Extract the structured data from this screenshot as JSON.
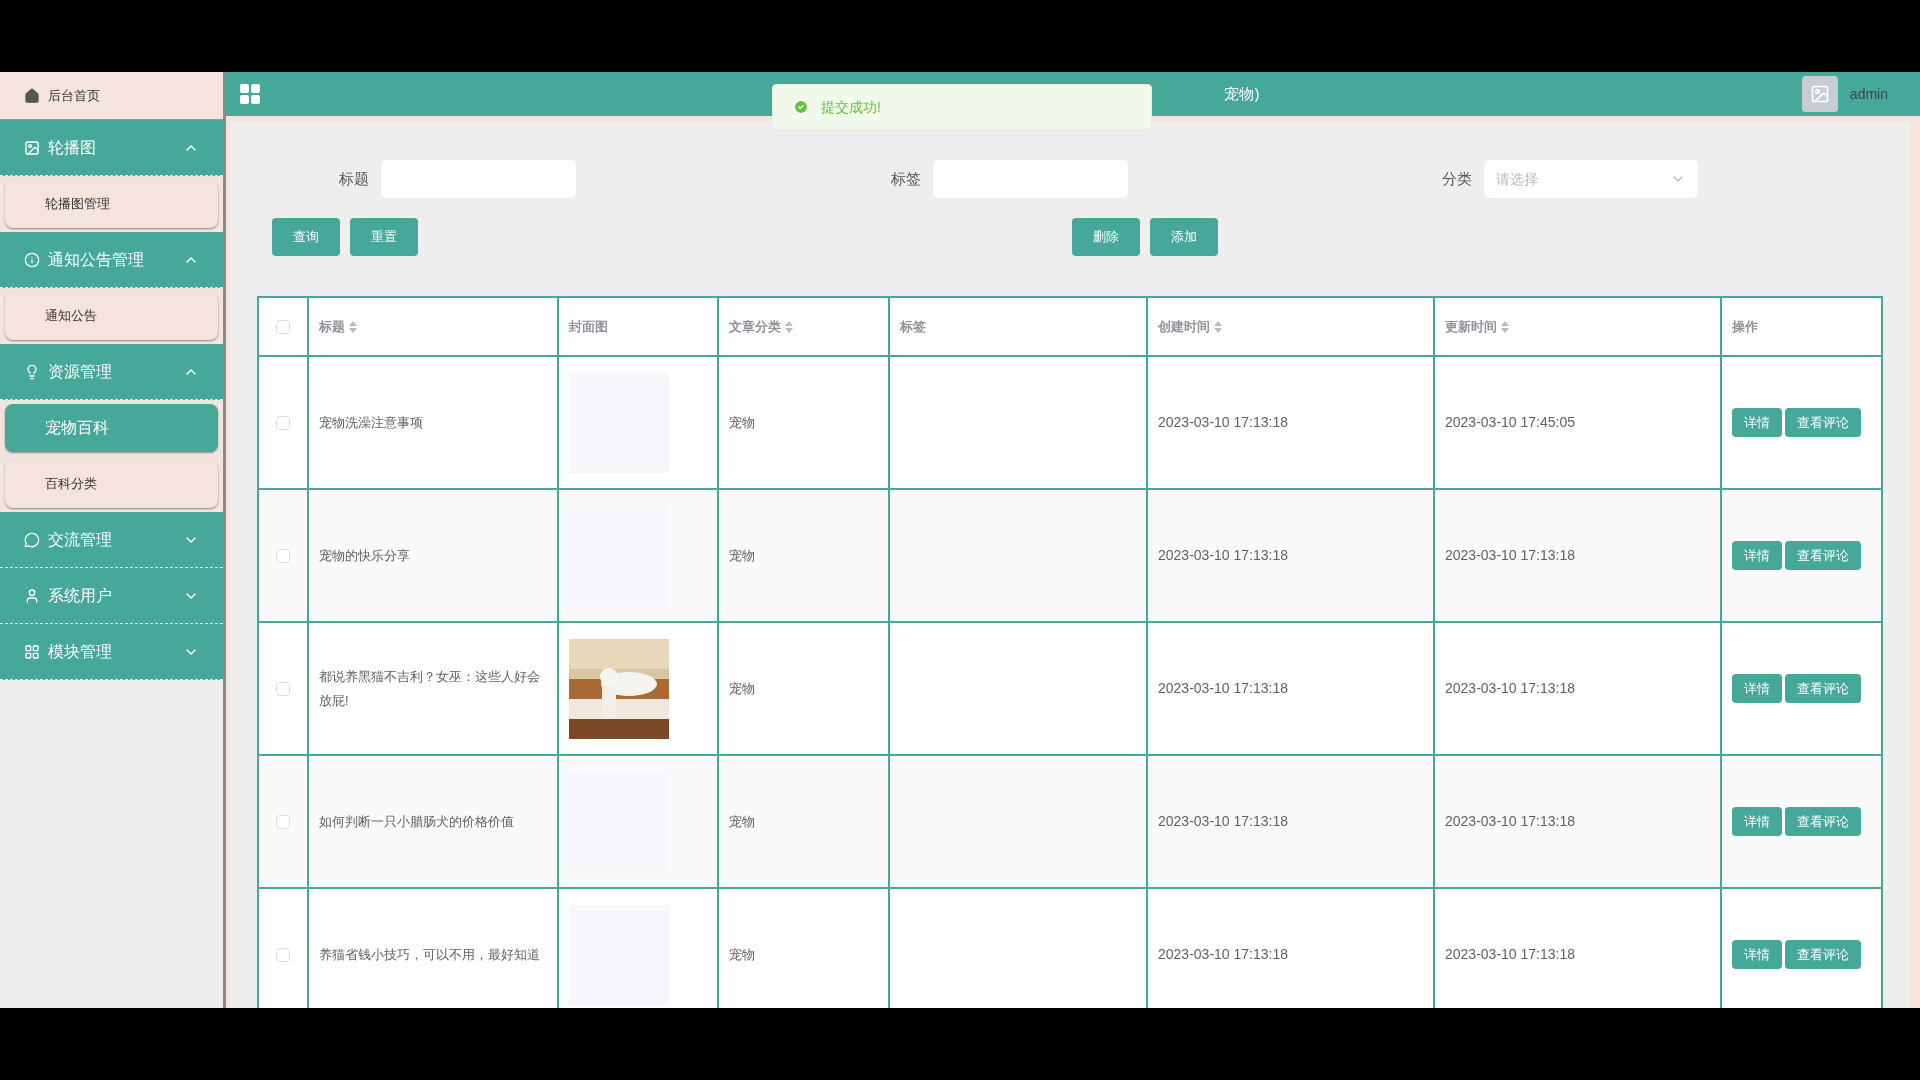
{
  "sidebar": {
    "home": {
      "label": "后台首页"
    },
    "groups": [
      {
        "label": "轮播图",
        "expanded": true,
        "children": [
          {
            "label": "轮播图管理",
            "selected": false
          }
        ]
      },
      {
        "label": "通知公告管理",
        "expanded": true,
        "children": [
          {
            "label": "通知公告",
            "selected": false
          }
        ]
      },
      {
        "label": "资源管理",
        "expanded": true,
        "children": [
          {
            "label": "宠物百科",
            "selected": true
          },
          {
            "label": "百科分类",
            "selected": false
          }
        ]
      },
      {
        "label": "交流管理",
        "expanded": false
      },
      {
        "label": "系统用户",
        "expanded": false
      },
      {
        "label": "模块管理",
        "expanded": false
      }
    ]
  },
  "header": {
    "title": "宠物)",
    "user": "admin"
  },
  "toast": {
    "message": "提交成功!"
  },
  "filters": [
    {
      "label": "标题",
      "kind": "input"
    },
    {
      "label": "标签",
      "kind": "input"
    },
    {
      "label": "分类",
      "kind": "select",
      "placeholder": "请选择"
    }
  ],
  "left_buttons": [
    "查询",
    "重置"
  ],
  "right_buttons": [
    "删除",
    "添加"
  ],
  "table": {
    "columns": [
      {
        "label": "标题",
        "sortable": true
      },
      {
        "label": "封面图",
        "sortable": false
      },
      {
        "label": "文章分类",
        "sortable": true
      },
      {
        "label": "标签",
        "sortable": false
      },
      {
        "label": "创建时间",
        "sortable": true
      },
      {
        "label": "更新时间",
        "sortable": true
      },
      {
        "label": "操作",
        "sortable": false
      }
    ],
    "header_checked": false,
    "rows": [
      {
        "checked": false,
        "title": "宠物洗澡注意事项",
        "category": "宠物",
        "created": "2023-03-10 17:13:18",
        "updated": "2023-03-10 17:45:05",
        "actions": [
          "详情",
          "查看评论"
        ]
      },
      {
        "checked": false,
        "title": "宠物的快乐分享",
        "category": "宠物",
        "created": "2023-03-10 17:13:18",
        "updated": "2023-03-10 17:13:18",
        "actions": [
          "详情",
          "查看评论"
        ]
      },
      {
        "checked": false,
        "title": "都说养黑猫不吉利？女巫：这些人好会放屁!",
        "cover": {
          "kind": "picture"
        },
        "category": "宠物",
        "created": "2023-03-10 17:13:18",
        "updated": "2023-03-10 17:13:18",
        "actions": [
          "详情",
          "查看评论"
        ]
      },
      {
        "checked": false,
        "title": "如何判断一只小腊肠犬的价格价值",
        "category": "宠物",
        "created": "2023-03-10 17:13:18",
        "updated": "2023-03-10 17:13:18",
        "actions": [
          "详情",
          "查看评论"
        ]
      },
      {
        "checked": false,
        "title": "养猫省钱小技巧，可以不用，最好知道",
        "category": "宠物",
        "created": "2023-03-10 17:13:18",
        "updated": "2023-03-10 17:13:18",
        "actions": [
          "详情",
          "查看评论"
        ]
      }
    ]
  }
}
